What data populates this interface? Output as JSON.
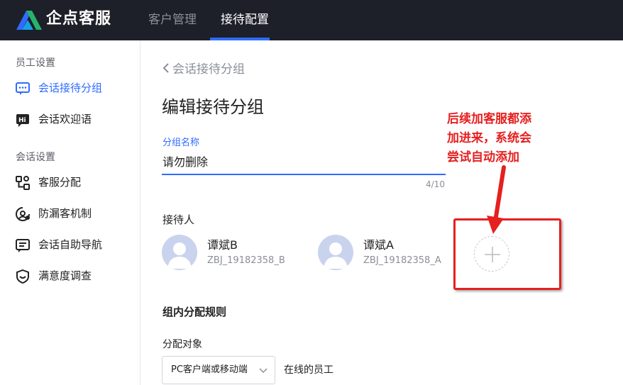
{
  "header": {
    "brand": "企点客服",
    "tabs": [
      {
        "label": "客户管理",
        "active": false
      },
      {
        "label": "接待配置",
        "active": true
      }
    ]
  },
  "sidebar": {
    "sections": [
      {
        "title": "员工设置",
        "items": [
          {
            "label": "会话接待分组",
            "icon": "chat-group-icon",
            "active": true
          },
          {
            "label": "会话欢迎语",
            "icon": "welcome-hi-icon",
            "active": false
          }
        ]
      },
      {
        "title": "会话设置",
        "items": [
          {
            "label": "客服分配",
            "icon": "distribution-icon",
            "active": false
          },
          {
            "label": "防漏客机制",
            "icon": "anti-loss-icon",
            "active": false
          },
          {
            "label": "会话自助导航",
            "icon": "self-navigation-icon",
            "active": false
          },
          {
            "label": "满意度调查",
            "icon": "satisfaction-icon",
            "active": false
          }
        ]
      }
    ]
  },
  "main": {
    "back_link": "会话接待分组",
    "title": "编辑接待分组",
    "group_name": {
      "label": "分组名称",
      "value": "请勿删除",
      "counter": "4/10"
    },
    "receivers": {
      "label": "接待人",
      "agents": [
        {
          "name": "谭斌B",
          "id": "ZBJ_19182358_B"
        },
        {
          "name": "谭斌A",
          "id": "ZBJ_19182358_A"
        }
      ]
    },
    "annotation": {
      "lines": [
        "后续加客服都添",
        "加进来，系统会",
        "尝试自动添加"
      ]
    },
    "rules": {
      "title": "组内分配规则",
      "target_label": "分配对象",
      "target_value": "PC客户端或移动端",
      "online_text": "在线的员工"
    }
  },
  "colors": {
    "topbar": "#1d1f29",
    "accent": "#2f6bff",
    "annotation_red": "#e5201f"
  }
}
